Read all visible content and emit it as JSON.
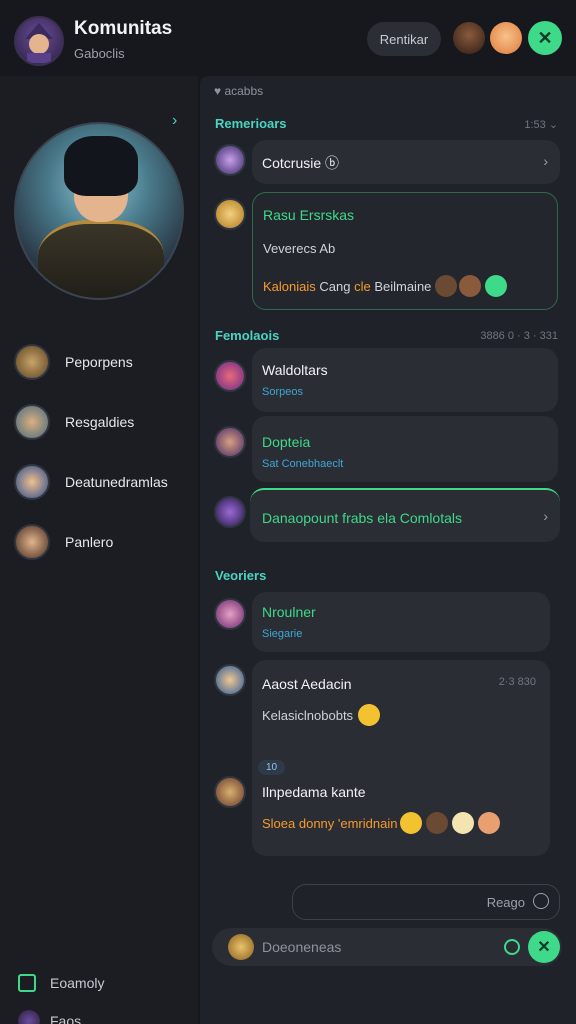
{
  "header": {
    "title": "Komunitas",
    "subtitle": "Gaboclis",
    "button_label": "Rentikar",
    "action_icon": "close-icon"
  },
  "sidebar": {
    "items": [
      {
        "label": "Peporpens"
      },
      {
        "label": "Resgaldies"
      },
      {
        "label": "Deatunedramlas"
      },
      {
        "label": "Panlero"
      }
    ],
    "footer": [
      {
        "label": "Eoamoly",
        "icon": "calendar-icon"
      },
      {
        "label": "Faos"
      }
    ]
  },
  "panel": {
    "header": "♥ acabbs",
    "sections": [
      {
        "title": "Remerioars",
        "meta": "1:53 ⌄"
      },
      {
        "title": "Femolaois",
        "meta": "3886 0 · 3 · 331"
      },
      {
        "title": "Veoriers"
      }
    ],
    "cards": {
      "c1": {
        "title": "Cotcrusie ⓑ"
      },
      "c2": {
        "title": "Rasu Ersrskas",
        "line1": "Veverecs Ab",
        "line2a": "Kaloniais",
        "line2b": " Cang ",
        "line2c": "cle",
        "line2d": " Beilmaine"
      },
      "c3": {
        "title": "Waldoltars",
        "sub": "Sorpeos"
      },
      "c4": {
        "title": "Dopteia",
        "sub": "Sat Conebhaeclt"
      },
      "c5": {
        "title": "Danaopount frabs ela Comlotals"
      },
      "c6": {
        "title": "Nroulner",
        "sub": "Siegarie"
      },
      "c7": {
        "title": "Aaost Aedacin",
        "time": "2·3 830",
        "line1": "Kelasiclnobobts",
        "tag": "10",
        "title2": "Ilnpedama kante",
        "line2": "Sloea donny 'emridnain"
      }
    },
    "reply_placeholder": "Reago",
    "input_placeholder": "Doeoneneas"
  },
  "colors": {
    "accent": "#3fd98a",
    "teal": "#4bd3c3",
    "orange": "#f59b2e",
    "blue": "#3fa7d6"
  }
}
